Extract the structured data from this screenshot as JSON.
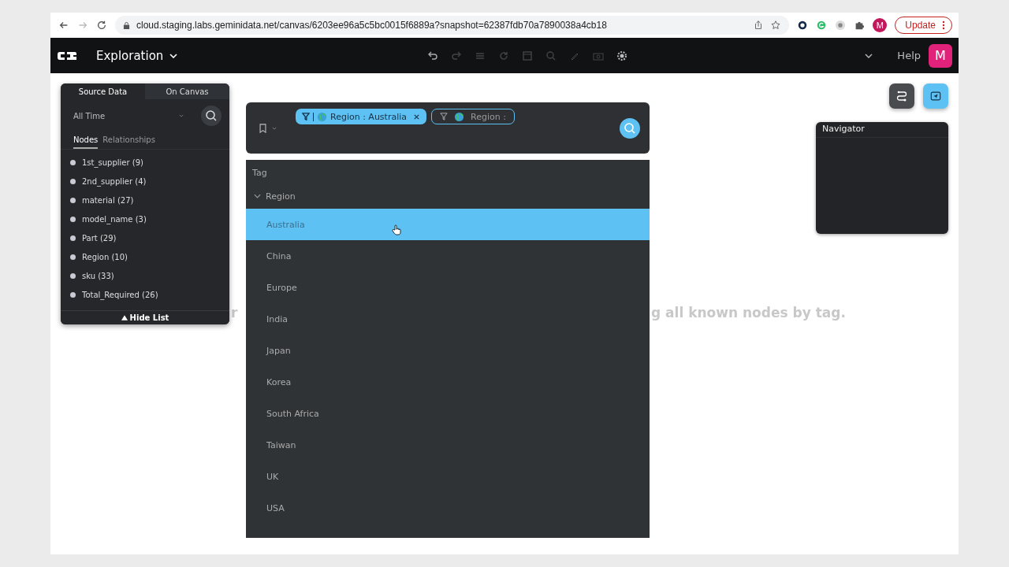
{
  "browser": {
    "url": "cloud.staging.labs.geminidata.net/canvas/6203ee96a5c5bc0015f6889a?snapshot=62387fdb70a7890038a4cb18",
    "profile": "M",
    "update_button": "Update"
  },
  "app_bar": {
    "title": "Exploration",
    "help": "Help",
    "avatar": "M"
  },
  "sidebar": {
    "tabs": [
      {
        "label": "Source Data",
        "selected": true
      },
      {
        "label": "On Canvas",
        "selected": false
      }
    ],
    "time_filter": "All Time",
    "subtabs": [
      {
        "label": "Nodes",
        "selected": true
      },
      {
        "label": "Relationships",
        "selected": false
      }
    ],
    "items": [
      {
        "label": "1st_supplier (9)"
      },
      {
        "label": "2nd_supplier (4)"
      },
      {
        "label": "material (27)"
      },
      {
        "label": "model_name (3)"
      },
      {
        "label": "Part (29)"
      },
      {
        "label": "Region (10)"
      },
      {
        "label": "sku (33)"
      },
      {
        "label": "Total_Required (26)"
      }
    ],
    "hide_button": "Hide List"
  },
  "search_bar": {
    "chips": [
      {
        "kind": "filled",
        "label": "Region : Australia"
      },
      {
        "kind": "outline",
        "label": "Region :"
      }
    ]
  },
  "dropdown": {
    "header": "Tag",
    "group": {
      "label": "Region",
      "expanded": true,
      "options": [
        {
          "label": "Australia",
          "selected": true
        },
        {
          "label": "China",
          "selected": false
        },
        {
          "label": "Europe",
          "selected": false
        },
        {
          "label": "India",
          "selected": false
        },
        {
          "label": "Japan",
          "selected": false
        },
        {
          "label": "Korea",
          "selected": false
        },
        {
          "label": "South Africa",
          "selected": false
        },
        {
          "label": "Taiwan",
          "selected": false
        },
        {
          "label": "UK",
          "selected": false
        },
        {
          "label": "USA",
          "selected": false
        }
      ]
    }
  },
  "canvas_hint": [
    "r",
    "g all known nodes by tag."
  ],
  "navigator": {
    "title": "Navigator"
  }
}
